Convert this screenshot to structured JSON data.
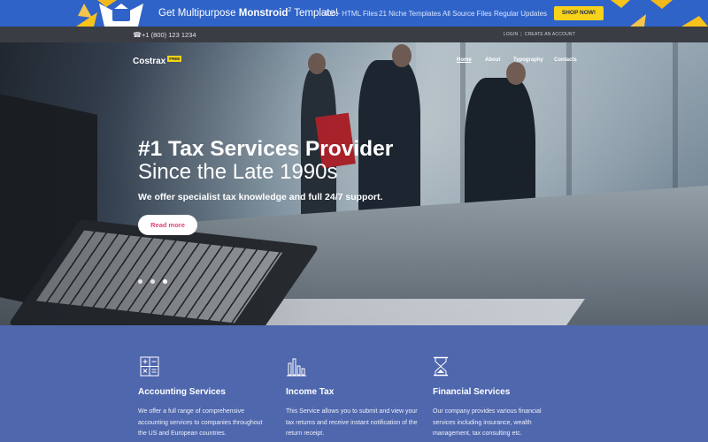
{
  "promo": {
    "tagline_prefix": "Get Multipurpose ",
    "tagline_brand": "Monstroid",
    "tagline_sup": "2",
    "tagline_suffix": " Template!",
    "features": [
      "400+ HTML Files",
      "21 Niche Templates",
      "All Source Files",
      "Regular Updates"
    ],
    "shop_label": "SHOP NOW!",
    "colors": {
      "background": "#2f63c8",
      "button": "#f7d21b"
    }
  },
  "topbar": {
    "phone_icon": "phone-icon",
    "phone": "+1 (800) 123 1234",
    "login": "LOGIN",
    "create_account": "CREATE AN ACCOUNT"
  },
  "header": {
    "brand": "Costrax",
    "badge": "FREE",
    "nav": [
      {
        "label": "Home",
        "active": true
      },
      {
        "label": "About",
        "active": false
      },
      {
        "label": "Typography",
        "active": false
      },
      {
        "label": "Contacts",
        "active": false
      }
    ]
  },
  "hero": {
    "title": "#1 Tax Services Provider",
    "subtitle": "Since the Late 1990s",
    "text": "We offer specialist tax knowledge and full 24/7 support.",
    "button": "Read more",
    "slides": 3
  },
  "services": [
    {
      "icon": "calculator-icon",
      "title": "Accounting Services",
      "text": "We offer a full range of comprehensive accounting services to companies throughout the US and European countries."
    },
    {
      "icon": "bar-chart-icon",
      "title": "Income Tax",
      "text": "This Service allows you to submit and view your tax returns and receive instant notification of the return receipt."
    },
    {
      "icon": "hourglass-icon",
      "title": "Financial Services",
      "text": "Our company provides various financial services including insurance, wealth management, tax consulting etc."
    }
  ]
}
